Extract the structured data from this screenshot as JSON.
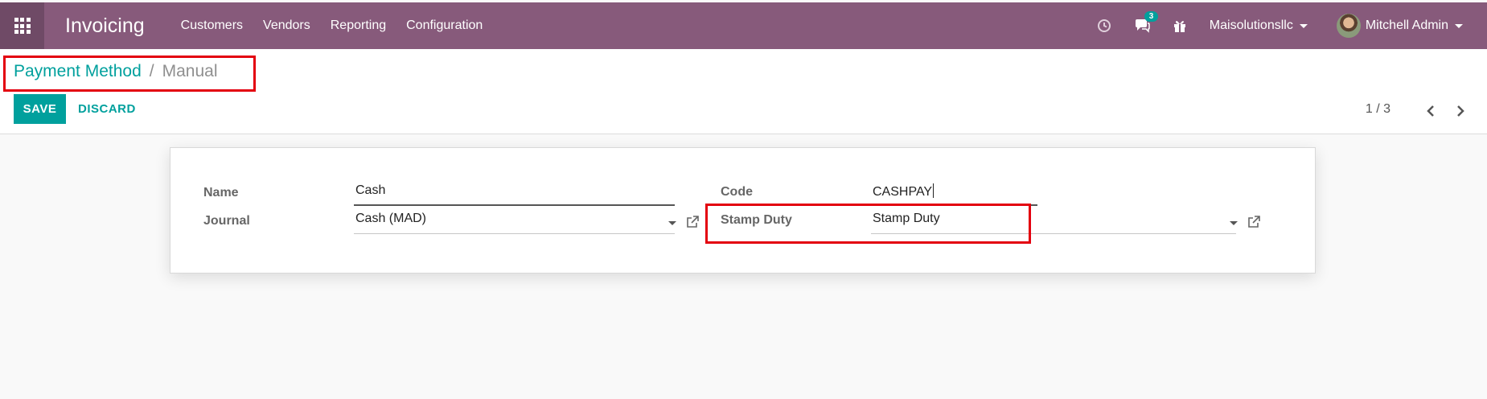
{
  "app": {
    "title": "Invoicing",
    "menu": [
      "Customers",
      "Vendors",
      "Reporting",
      "Configuration"
    ]
  },
  "navbar_right": {
    "activity_icon": "clock-icon",
    "messages_icon": "chat-icon",
    "messages_count": "3",
    "gift_icon": "gift-icon",
    "company": "Maisolutionsllc",
    "user": "Mitchell Admin"
  },
  "breadcrumb": {
    "parent": "Payment Method",
    "separator": "/",
    "current": "Manual"
  },
  "actions": {
    "save": "SAVE",
    "discard": "DISCARD"
  },
  "pager": {
    "text": "1 / 3"
  },
  "form": {
    "name_label": "Name",
    "name_value": "Cash",
    "journal_label": "Journal",
    "journal_value": "Cash (MAD)",
    "code_label": "Code",
    "code_value": "CASHPAY",
    "stamp_duty_label": "Stamp Duty",
    "stamp_duty_value": "Stamp Duty"
  },
  "colors": {
    "navbar": "#875a7b",
    "accent": "#00a09d",
    "highlight": "#e3000f"
  }
}
